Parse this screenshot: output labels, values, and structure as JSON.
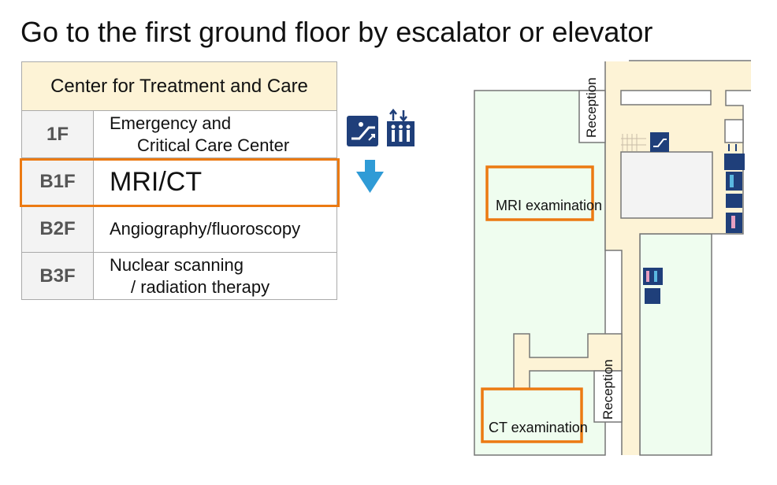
{
  "title": "Go to the first ground floor by escalator or elevator",
  "table": {
    "header": "Center for Treatment and Care",
    "rows": [
      {
        "floor": "1F",
        "line1": "Emergency and",
        "line2": "Critical Care Center"
      },
      {
        "floor": "B1F",
        "line1": "MRI/CT"
      },
      {
        "floor": "B2F",
        "line1": "Angiography/fluoroscopy"
      },
      {
        "floor": "B3F",
        "line1": "Nuclear scanning",
        "line2": "/ radiation therapy"
      }
    ],
    "highlighted_floor": "B1F"
  },
  "icons": [
    "escalator-icon",
    "elevator-icon",
    "down-arrow-icon",
    "restroom-icon",
    "multipurpose-toilet-icon",
    "stairs-icon"
  ],
  "map": {
    "reception_top": "Reception",
    "reception_bottom": "Reception",
    "mri": "MRI examination",
    "ct": "CT examination"
  },
  "colors": {
    "highlight": "#ec7a12",
    "corridor": "#fdf3d6",
    "room": "#effdef",
    "icon": "#1f3f7a",
    "arrow": "#2f9bd6"
  }
}
